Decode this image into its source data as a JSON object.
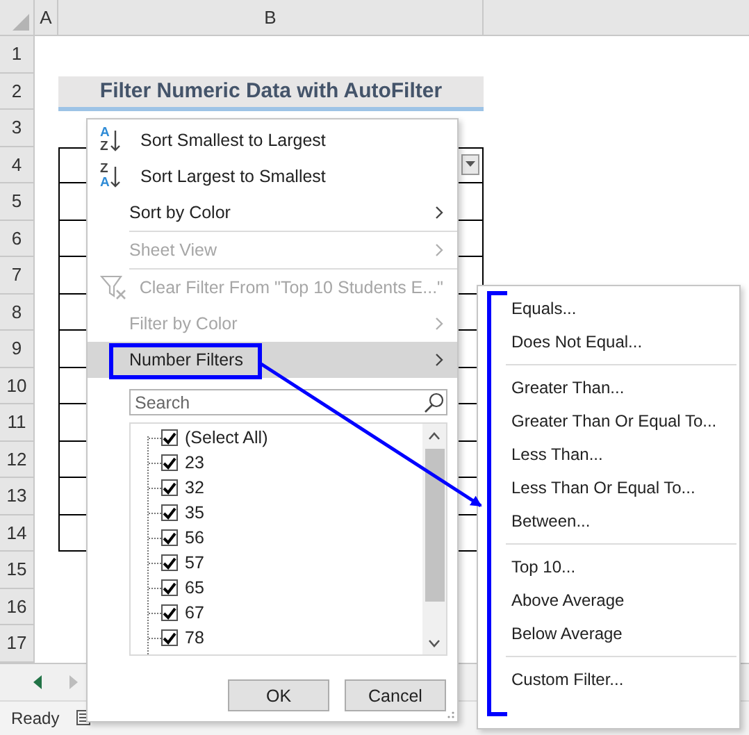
{
  "sheet": {
    "columns": [
      "A",
      "B"
    ],
    "rows": [
      "1",
      "2",
      "3",
      "4",
      "5",
      "6",
      "7",
      "8",
      "9",
      "10",
      "11",
      "12",
      "13",
      "14",
      "15",
      "16",
      "17"
    ],
    "title": "Filter Numeric Data with AutoFilter"
  },
  "filter_menu": {
    "items": [
      {
        "kind": "sort",
        "icon": [
          "A",
          "Z"
        ],
        "label": "Sort Smallest to Largest",
        "disabled": false,
        "selected": false,
        "has_submenu": false
      },
      {
        "kind": "sort",
        "icon": [
          "Z",
          "A"
        ],
        "label": "Sort Largest to Smallest",
        "disabled": false,
        "selected": false,
        "has_submenu": false
      },
      {
        "kind": "item",
        "label": "Sort by Color",
        "disabled": false,
        "selected": false,
        "has_submenu": true
      },
      {
        "kind": "separator"
      },
      {
        "kind": "item",
        "label": "Sheet View",
        "disabled": true,
        "selected": false,
        "has_submenu": true
      },
      {
        "kind": "separator"
      },
      {
        "kind": "clear",
        "label": "Clear Filter From \"Top 10 Students E...\"",
        "disabled": true,
        "selected": false,
        "has_submenu": false
      },
      {
        "kind": "item",
        "label": "Filter by Color",
        "disabled": true,
        "selected": false,
        "has_submenu": true
      },
      {
        "kind": "item",
        "label": "Number Filters",
        "disabled": false,
        "selected": true,
        "has_submenu": true
      }
    ],
    "search": {
      "placeholder": "Search"
    },
    "values": [
      {
        "label": "(Select All)",
        "checked": true
      },
      {
        "label": "23",
        "checked": true
      },
      {
        "label": "32",
        "checked": true
      },
      {
        "label": "35",
        "checked": true
      },
      {
        "label": "56",
        "checked": true
      },
      {
        "label": "57",
        "checked": true
      },
      {
        "label": "65",
        "checked": true
      },
      {
        "label": "67",
        "checked": true
      },
      {
        "label": "78",
        "checked": true
      }
    ],
    "buttons": [
      "OK",
      "Cancel"
    ]
  },
  "number_filters_menu": {
    "groups": [
      [
        "Equals...",
        "Does Not Equal..."
      ],
      [
        "Greater Than...",
        "Greater Than Or Equal To...",
        "Less Than...",
        "Less Than Or Equal To...",
        "Between..."
      ],
      [
        "Top 10...",
        "Above Average",
        "Below Average"
      ],
      [
        "Custom Filter..."
      ]
    ]
  },
  "status_bar": {
    "text": "Ready"
  }
}
